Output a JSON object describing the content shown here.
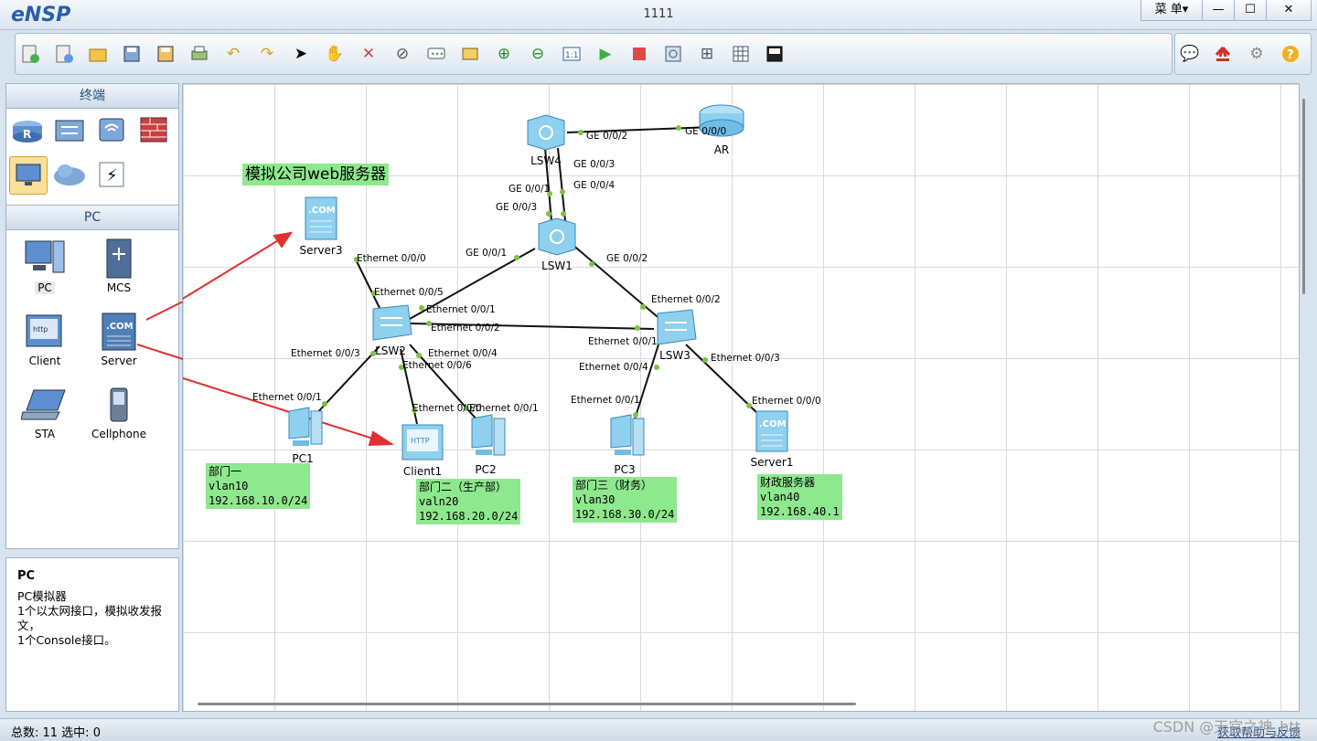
{
  "app": {
    "logo": "eNSP",
    "title": "1111",
    "menu_label": "菜 单▾",
    "minimize_label": "—",
    "maximize_label": "☐",
    "close_label": "✕"
  },
  "toolbar": {
    "icons": [
      "new-topology-icon",
      "new-example-icon",
      "open-icon",
      "save-icon",
      "save-as-icon",
      "print-icon",
      "undo-icon",
      "redo-icon",
      "select-icon",
      "pan-hand-icon",
      "delete-icon",
      "delete-link-icon",
      "add-text-icon",
      "add-shape-icon",
      "zoom-in-icon",
      "zoom-out-icon",
      "fit-view-icon",
      "start-device-icon",
      "stop-device-icon",
      "capture-icon",
      "topology-icon",
      "grid-icon",
      "show-interface-icon"
    ],
    "right_icons": [
      "chat-icon",
      "huawei-logo-icon",
      "settings-gear-icon",
      "help-icon"
    ]
  },
  "left_panel": {
    "category_title": "终端",
    "category_icons": [
      "router-icon",
      "switch-icon",
      "wireless-icon",
      "firewall-icon",
      "pc-terminal-icon",
      "cloud-icon",
      "power-link-icon"
    ],
    "selected_category": 4,
    "devices_title": "PC",
    "devices": [
      {
        "label": "PC",
        "icon": "pc-icon"
      },
      {
        "label": "MCS",
        "icon": "mcs-icon"
      },
      {
        "label": "Client",
        "icon": "client-icon"
      },
      {
        "label": "Server",
        "icon": "server-icon"
      },
      {
        "label": "STA",
        "icon": "sta-laptop-icon"
      },
      {
        "label": "Cellphone",
        "icon": "cellphone-icon"
      }
    ]
  },
  "description": {
    "title": "PC",
    "text": "PC模拟器\n1个以太网接口，模拟收发报文，\n1个Console接口。"
  },
  "topology": {
    "nodes": [
      {
        "id": "LSW4",
        "label": "LSW4",
        "type": "switch-l3"
      },
      {
        "id": "AR",
        "label": "AR",
        "type": "router"
      },
      {
        "id": "LSW1",
        "label": "LSW1",
        "type": "switch-l3"
      },
      {
        "id": "LSW2",
        "label": "LSW2",
        "type": "switch"
      },
      {
        "id": "LSW3",
        "label": "LSW3",
        "type": "switch"
      },
      {
        "id": "Server3",
        "label": "Server3",
        "type": "server"
      },
      {
        "id": "PC1",
        "label": "PC1",
        "type": "pc"
      },
      {
        "id": "Client1",
        "label": "Client1",
        "type": "client"
      },
      {
        "id": "PC2",
        "label": "PC2",
        "type": "pc"
      },
      {
        "id": "PC3",
        "label": "PC3",
        "type": "pc"
      },
      {
        "id": "Server1",
        "label": "Server1",
        "type": "server"
      }
    ],
    "port_labels": [
      "GE 0/0/2",
      "GE 0/0/0",
      "GE 0/0/3",
      "GE 0/0/4",
      "GE 0/0/1",
      "GE 0/0/3",
      "GE 0/0/1",
      "GE 0/0/2",
      "Ethernet 0/0/0",
      "Ethernet 0/0/5",
      "Ethernet 0/0/1",
      "Ethernet 0/0/2",
      "Ethernet 0/0/3",
      "Ethernet 0/0/6",
      "Ethernet 0/0/4",
      "Ethernet 0/0/1",
      "Ethernet 0/0/0",
      "Ethernet 0/0/1",
      "Ethernet 0/0/2",
      "Ethernet 0/0/1",
      "Ethernet 0/0/4",
      "Ethernet 0/0/3",
      "Ethernet 0/0/1",
      "Ethernet 0/0/0"
    ],
    "notes": [
      "模拟公司web服务器",
      "部门一\nvlan10\n192.168.10.0/24",
      "部门二（生产部）\nvaln20\n192.168.20.0/24",
      "部门三（财务）\nvlan30\n192.168.30.0/24",
      "财政服务器\nvlan40\n192.168.40.1"
    ]
  },
  "colors": {
    "link": "#111111",
    "port_dot": "#7dc241",
    "note_bg": "#8ee88e",
    "arrow": "#e03030"
  },
  "status": {
    "text": "总数: 11  选中: 0",
    "feedback": "获取帮助与反馈"
  },
  "watermark": "CSDN @天宫之神_htt"
}
